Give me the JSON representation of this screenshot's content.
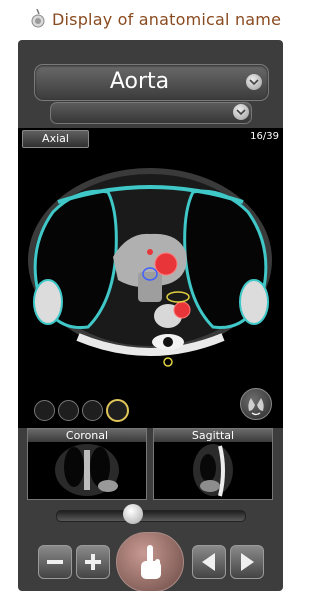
{
  "header": {
    "title": "Display of anatomical name"
  },
  "selector": {
    "structure": "Aorta",
    "sub_value": ""
  },
  "viewport": {
    "view_label": "Axial",
    "slice_counter": "16/39"
  },
  "previews": {
    "coronal_label": "Coronal",
    "sagittal_label": "Sagittal"
  },
  "slider": {
    "position_fraction": 0.4
  },
  "thumbnails": [
    "thumb-1",
    "thumb-2",
    "thumb-3",
    "thumb-4"
  ],
  "icons": {
    "header": "stopwatch-icon",
    "chevron": "chevron-down-icon",
    "rotate": "lung-rotate-icon",
    "zoom_out": "minus-icon",
    "zoom_in": "plus-icon",
    "touch": "touch-hand-icon",
    "prev": "triangle-left-icon",
    "next": "triangle-right-icon"
  },
  "colors": {
    "title": "#8a4a1f",
    "aorta_highlight": "#e8353a",
    "muscle_outline": "#40c8c8",
    "structure_outline_yellow": "#e0d040",
    "structure_outline_blue": "#4060ff",
    "touch_button": "#b08a84"
  }
}
